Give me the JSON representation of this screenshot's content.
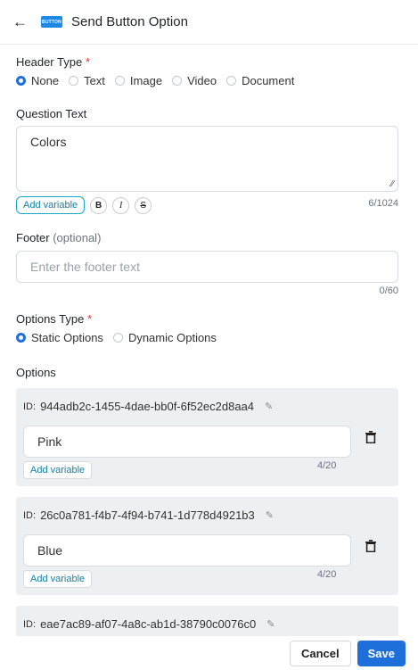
{
  "header": {
    "back_icon": "arrow-left-icon",
    "badge": "BUTTON",
    "title": "Send Button Option"
  },
  "header_type": {
    "label": "Header Type",
    "required": "*",
    "options": [
      "None",
      "Text",
      "Image",
      "Video",
      "Document"
    ],
    "selected": "None"
  },
  "question": {
    "label": "Question Text",
    "value": "Colors",
    "counter": "6/1024",
    "add_variable": "Add variable",
    "bold": "B",
    "italic": "I",
    "strike": "S"
  },
  "footer_field": {
    "label": "Footer",
    "optional": "(optional)",
    "placeholder": "Enter the footer text",
    "counter": "0/60"
  },
  "options_type": {
    "label": "Options Type",
    "required": "*",
    "options": [
      "Static Options",
      "Dynamic Options"
    ],
    "selected": "Static Options"
  },
  "options": {
    "label": "Options",
    "id_prefix": "ID:",
    "items": [
      {
        "id": "944adb2c-1455-4dae-bb0f-6f52ec2d8aa4",
        "value": "Pink",
        "counter": "4/20",
        "add_variable": "Add variable"
      },
      {
        "id": "26c0a781-f4b7-4f94-b741-1d778d4921b3",
        "value": "Blue",
        "counter": "4/20",
        "add_variable": "Add variable"
      },
      {
        "id": "eae7ac89-af07-4a8c-ab1d-38790c0076c0"
      }
    ]
  },
  "actions": {
    "cancel": "Cancel",
    "save": "Save"
  },
  "colors": {
    "primary": "#1e6fd9",
    "required": "#e53935",
    "accent": "#19a7c7"
  }
}
